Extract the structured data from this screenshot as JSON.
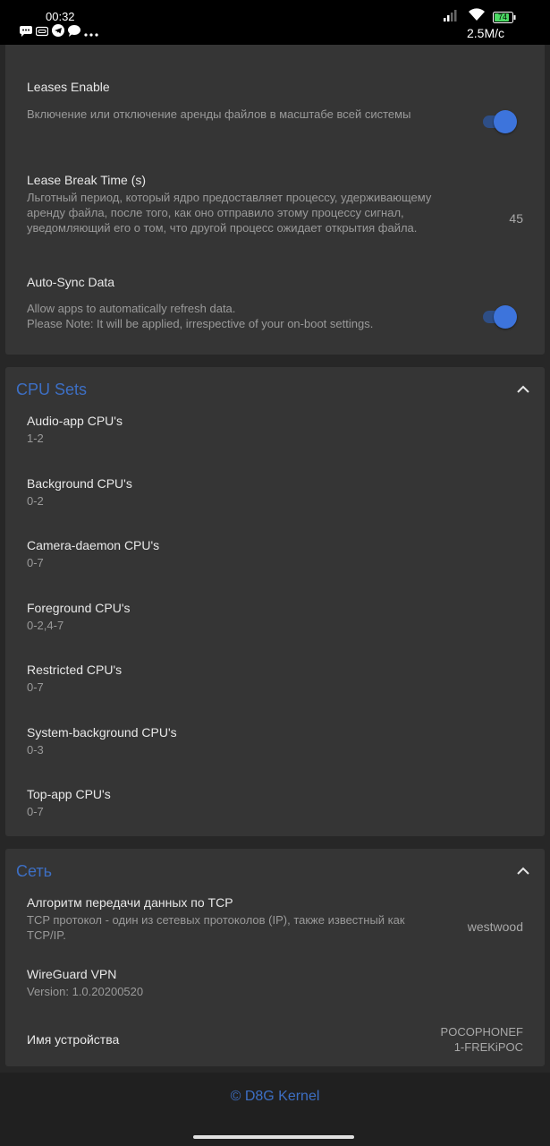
{
  "status_bar": {
    "time": "00:32",
    "net_speed": "2.5M/c",
    "battery": "74",
    "icons": [
      "chat-icon",
      "link-icon",
      "telegram-icon",
      "message-icon",
      "more-icon"
    ]
  },
  "kernel_settings": {
    "leases_enable": {
      "title": "Leases Enable",
      "desc": "Включение или отключение аренды файлов в масштабе всей системы",
      "enabled": true
    },
    "lease_break_time": {
      "title": "Lease Break Time (s)",
      "desc": "Льготный период, который ядро предоставляет процессу, удерживающему аренду файла, после того, как оно отправило этому процессу сигнал, уведомляющий его о том, что другой процесс ожидает открытия файла.",
      "value": "45"
    },
    "auto_sync": {
      "title": "Auto-Sync Data",
      "desc_line1": "Allow apps to automatically refresh data.",
      "desc_line2": "Please Note: It will be applied, irrespective of your on-boot settings.",
      "enabled": true
    }
  },
  "cpu_sets": {
    "title": "CPU Sets",
    "items": [
      {
        "title": "Audio-app CPU's",
        "value": "1-2"
      },
      {
        "title": "Background CPU's",
        "value": "0-2"
      },
      {
        "title": "Camera-daemon CPU's",
        "value": "0-7"
      },
      {
        "title": "Foreground CPU's",
        "value": "0-2,4-7"
      },
      {
        "title": "Restricted CPU's",
        "value": "0-7"
      },
      {
        "title": "System-background CPU's",
        "value": "0-3"
      },
      {
        "title": "Top-app CPU's",
        "value": "0-7"
      }
    ]
  },
  "network": {
    "title": "Сеть",
    "tcp": {
      "title": "Алгоритм передачи данных по TCP",
      "desc": "TCP протокол - один из сетевых протоколов (IP), также известный как TCP/IP.",
      "value": "westwood"
    },
    "wireguard": {
      "title": "WireGuard VPN",
      "desc": "Version: 1.0.20200520"
    },
    "device_name": {
      "title": "Имя устройства",
      "value_line1": "POCOPHONEF",
      "value_line2": "1-FREKiPOC"
    }
  },
  "footer": {
    "text": "© D8G Kernel"
  },
  "colors": {
    "accent": "#3d6fc4",
    "toggle_on": "#3d74dc",
    "card": "#353535",
    "background": "#272727"
  }
}
